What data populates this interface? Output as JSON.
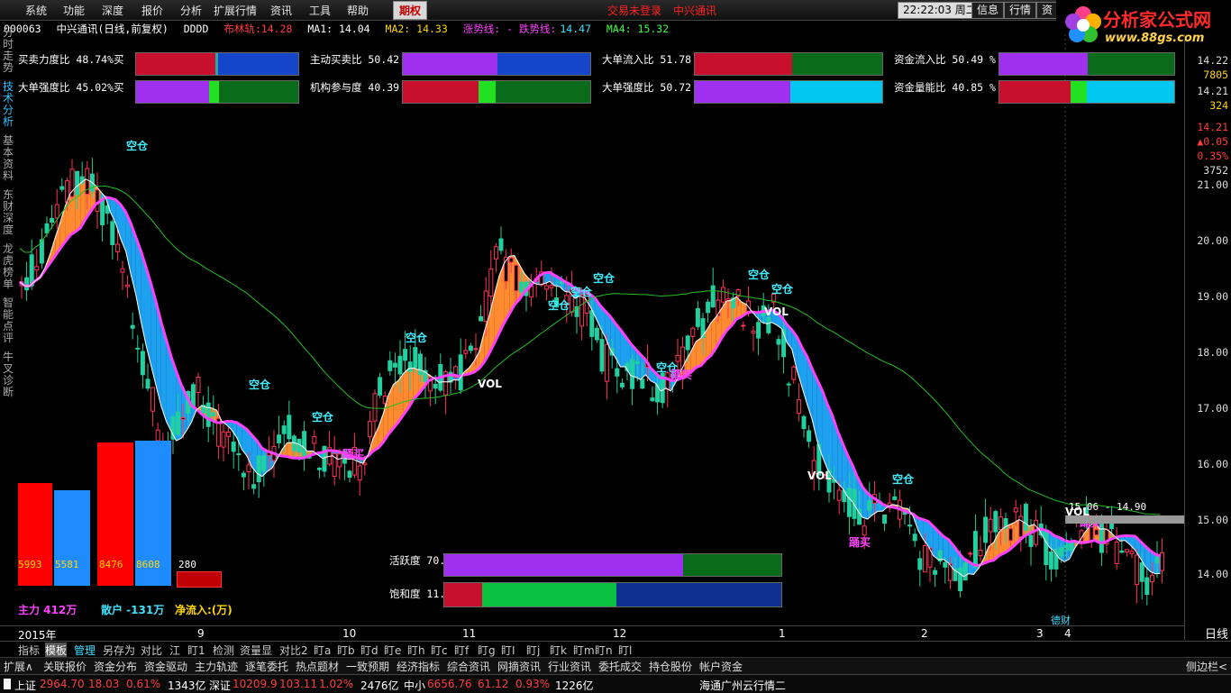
{
  "menu": {
    "items": [
      "系统",
      "功能",
      "深度",
      "报价",
      "分析",
      "扩展行情",
      "资讯",
      "工具",
      "帮助"
    ],
    "selected": "期权",
    "notice1": "交易未登录",
    "notice2": "中兴通讯",
    "clock": "22:22:03 周二",
    "right_buttons": [
      "信息",
      "行情",
      "资"
    ]
  },
  "logo": {
    "title": "分析家公式网",
    "url": "www.88gs.com"
  },
  "header": {
    "code": "000063",
    "name": "中兴通讯(日线,前复权)",
    "dddd": "DDDD",
    "bulin_label": "布林轨:",
    "bulin_val": "14.28",
    "ma1": "MA1: 14.04",
    "ma2": "MA2: 14.33",
    "trend": "涨势线: - 跌势线:",
    "trend_val": "14.47",
    "ma4": "MA4: 15.32"
  },
  "indicators": [
    {
      "label": "买卖力度比 48.74%买",
      "segs": [
        [
          "#c8102e",
          48.74
        ],
        [
          "#2aa",
          2
        ],
        [
          "#1545c8",
          49.26
        ]
      ]
    },
    {
      "label": "主动买卖比 50.42 %",
      "segs": [
        [
          "#a030f0",
          50.42
        ],
        [
          "#1545c8",
          49.58
        ]
      ]
    },
    {
      "label": "大单流入比 51.78 %买",
      "segs": [
        [
          "#c8102e",
          51.78
        ],
        [
          "#0a6b1a",
          48.22
        ]
      ]
    },
    {
      "label": "资金流入比 50.49 %",
      "segs": [
        [
          "#a030f0",
          50.49
        ],
        [
          "#0a6b1a",
          49.51
        ]
      ]
    },
    {
      "label": "大单强度比 45.02%买",
      "segs": [
        [
          "#a030f0",
          45.02
        ],
        [
          "#22e022",
          6
        ],
        [
          "#0a6b1a",
          48.98
        ]
      ]
    },
    {
      "label": "机构参与度 40.39 %",
      "segs": [
        [
          "#c8102e",
          40.39
        ],
        [
          "#22e022",
          9
        ],
        [
          "#0a6b1a",
          50.61
        ]
      ]
    },
    {
      "label": "大单强度比 50.72 %买",
      "segs": [
        [
          "#a030f0",
          50.72
        ],
        [
          "#00c8f0",
          49.28
        ]
      ]
    },
    {
      "label": "资金量能比 40.85 %",
      "segs": [
        [
          "#c8102e",
          40.85
        ],
        [
          "#22e022",
          9
        ],
        [
          "#00c8f0",
          50.15
        ]
      ]
    }
  ],
  "left_tabs": [
    "分时走势",
    "技术分析",
    "基本资料",
    "东财深度",
    "龙虎榜单",
    "智能点评",
    "牛叉诊断"
  ],
  "right_axis": {
    "top_values": [
      "14.22",
      "7805",
      "14.21",
      "324",
      "14.21",
      "▲0.05",
      "0.35%",
      "3752"
    ],
    "price_ticks": [
      "21.00",
      "20.00",
      "19.00",
      "18.00",
      "17.00",
      "16.00",
      "15.00",
      "14.00"
    ],
    "corner": "日线",
    "corner2": "+ - ○"
  },
  "chart_data": {
    "type": "candlestick",
    "x_labels": [
      "2015年",
      "9",
      "10",
      "11",
      "12",
      "1",
      "2",
      "3",
      "4"
    ],
    "ylim": [
      13.3,
      22.3
    ],
    "annotations": [
      "空仓",
      "空仓",
      "空仓",
      "空仓",
      "空仓",
      "空仓",
      "空仓",
      "空仓",
      "空仓",
      "空仓",
      "空仓",
      "VOL",
      "VOL",
      "VOL",
      "VOL",
      "踊买",
      "踊买",
      "踊买",
      "踊买"
    ],
    "range_label": "15.06 - 14.90",
    "note": "德财"
  },
  "flow_bars": {
    "values": [
      "5993",
      "5581",
      "8476",
      "8608",
      "280"
    ],
    "zhuli": "主力 412万",
    "sanhu": "散户 -131万",
    "jingliu": "净流入:(万)"
  },
  "activity": [
    {
      "label": "活跃度 70.91 %",
      "segs": [
        [
          "#a030f0",
          70.91
        ],
        [
          "#0a6b1a",
          29.09
        ]
      ]
    },
    {
      "label": "饱和度 11.20 %",
      "segs": [
        [
          "#c8102e",
          11.2
        ],
        [
          "#0ac040",
          40
        ],
        [
          "#103090",
          48.8
        ]
      ]
    }
  ],
  "tab_row": [
    "指标",
    "模板",
    "管理",
    "另存为",
    "对比",
    "江",
    "盯1",
    "检测",
    "资量显",
    "对比2",
    "盯a",
    "盯b",
    "盯d",
    "盯e",
    "盯h",
    "盯c",
    "盯f",
    "盯g",
    "盯I",
    "盯j",
    "盯k",
    "盯m",
    "盯n",
    "盯l"
  ],
  "func_row": [
    "扩展∧",
    "关联报价",
    "资金分布",
    "资金驱动",
    "主力轨迹",
    "逐笔委托",
    "热点题材",
    "一致预期",
    "经济指标",
    "综合资讯",
    "网摘资讯",
    "行业资讯",
    "委托成交",
    "持仓股份",
    "帐户资金"
  ],
  "func_right": "侧边栏<",
  "status": {
    "sh_label": "上证",
    "sh_val": "2964.70",
    "sh_chg": "18.03",
    "sh_pct": "0.61%",
    "sh_amt": "1343亿",
    "sz_label": "深证",
    "sz_val": "10209.9",
    "sz_chg": "103.11",
    "sz_pct": "1.02%",
    "sz_amt": "2476亿",
    "zx_label": "中小",
    "zx_val": "6656.76",
    "zx_chg": "61.12",
    "zx_pct": "0.93%",
    "zx_amt": "1226亿",
    "broker": "海通广州云行情二"
  }
}
